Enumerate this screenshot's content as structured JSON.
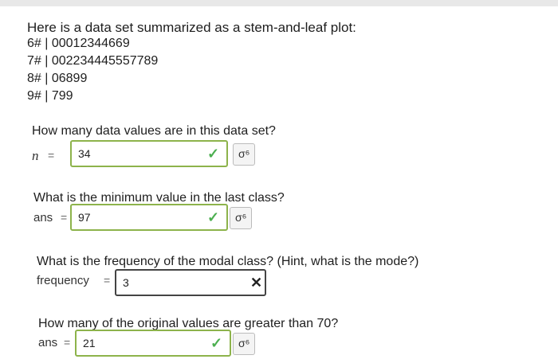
{
  "intro": "Here is a data set summarized as a stem-and-leaf plot:",
  "stem_plot": [
    "6# | 00012344669",
    "7# | 002234445557789",
    "8# | 06899",
    "9# | 799"
  ],
  "questions": [
    {
      "prompt": "How many data values are in this data set?",
      "label": "n",
      "eq": "=",
      "value": "34",
      "status": "correct",
      "status_icon": "check-icon"
    },
    {
      "prompt": "What is the minimum value in the last class?",
      "label": "ans",
      "eq": "=",
      "value": "97",
      "status": "correct",
      "status_icon": "check-icon"
    },
    {
      "prompt": "What is the frequency of the modal class? (Hint, what is the mode?)",
      "label": "frequency",
      "eq": "=",
      "value": "3",
      "status": "incorrect",
      "status_icon": "cross-icon"
    },
    {
      "prompt": "How many of the original values are greater than 70?",
      "label": "ans",
      "eq": "=",
      "value": "21",
      "status": "correct",
      "status_icon": "check-icon"
    }
  ],
  "icons": {
    "check": "✓",
    "cross": "✕",
    "key": "σ⁶"
  },
  "colors": {
    "correct_border": "#8db34b",
    "check": "#4caf50",
    "incorrect_border": "#444444"
  }
}
